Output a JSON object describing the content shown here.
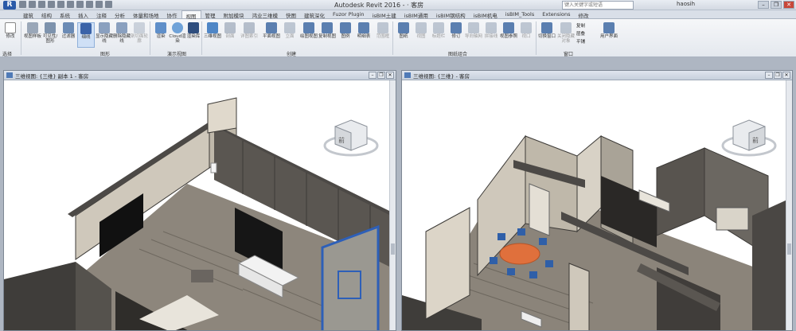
{
  "app": {
    "logo": "R",
    "title": "Autodesk Revit 2016 -  · 客房",
    "search_placeholder": "键入关键字或短语",
    "user": "haosih",
    "window_controls": [
      "–",
      "❐",
      "✕"
    ]
  },
  "tabs": [
    "建筑",
    "结构",
    "系统",
    "插入",
    "注释",
    "分析",
    "体量和场地",
    "协作",
    "视图",
    "管理",
    "附加模块",
    "鸿业三维模",
    "快图",
    "建筑深化",
    "Fuzor Plugin",
    "isBIM土建",
    "isBIM通用",
    "isBIM钢结构",
    "isBIM机电",
    "isBIM_Tools",
    "Extensions",
    "修改"
  ],
  "active_tab": "视图",
  "ribbon": {
    "buttons": [
      "修改",
      "视图样板",
      "可见性/图形",
      "过滤器",
      "细线",
      "显示隐藏线",
      "删除隐藏线",
      "剖切面轮廓",
      "渲染",
      "Cloud渲染",
      "渲染库",
      "三维视图",
      "剖面",
      "详图索引",
      "平面视图",
      "立面",
      "绘图视图",
      "复制视图",
      "图例",
      "明细表",
      "范围框",
      "图纸",
      "视图",
      "标题栏",
      "修订",
      "导向轴网",
      "拼接线",
      "视图参照",
      "视口",
      "切换窗口",
      "关闭隐藏对象",
      "复制",
      "层叠",
      "平铺",
      "用户界面"
    ],
    "groups": [
      "选择",
      "图形",
      "演示视图",
      "创建",
      "图纸组合",
      "窗口"
    ]
  },
  "views": {
    "left_title": "三维视图: {三维} 副本 1 - 客房",
    "right_title": "三维视图: {三维} - 客房",
    "viewcube_left": "前",
    "viewcube_right": "前"
  },
  "colors": {
    "wall_dark": "#4a4744",
    "wall_light": "#cfc9bd",
    "floor": "#8b847a",
    "table": "#e0703c",
    "chairs": "#2f5fa8",
    "panel_blue": "#2d5fb8"
  }
}
